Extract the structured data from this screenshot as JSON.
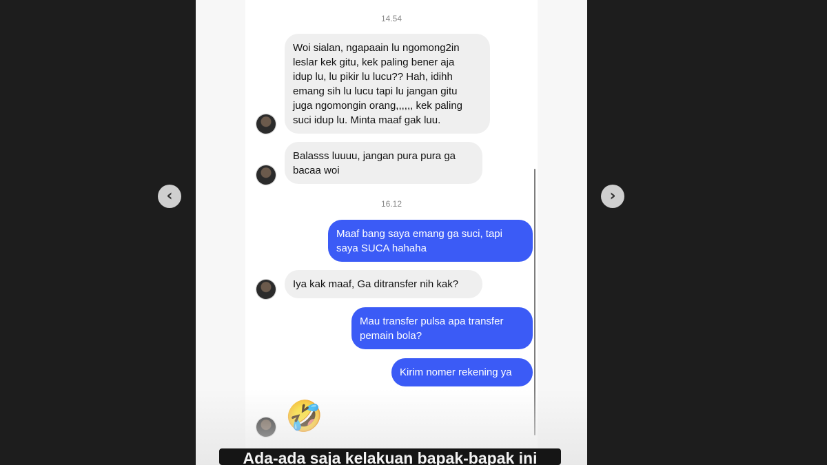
{
  "timestamps": [
    "14.54",
    "16.12"
  ],
  "messages": [
    {
      "direction": "incoming",
      "text": "Woi sialan, ngapaain lu ngomong2in\nleslar kek gitu, kek paling bener aja\nidup lu, lu pikir lu lucu?? Hah, idihh\nemang sih lu lucu tapi lu jangan gitu\njuga ngomongin orang,,,,,, kek paling\nsuci idup lu. Minta maaf gak luu."
    },
    {
      "direction": "incoming",
      "text": "Balasss luuuu, jangan pura pura ga\nbacaa woi"
    },
    {
      "direction": "outgoing",
      "text": "Maaf bang saya emang ga suci, tapi\nsaya SUCA hahaha"
    },
    {
      "direction": "incoming",
      "text": "Iya kak maaf, Ga ditransfer nih kak?"
    },
    {
      "direction": "outgoing",
      "text": "Mau transfer pulsa apa transfer\npemain bola?"
    },
    {
      "direction": "outgoing",
      "text": "Kirim nomer rekening ya"
    },
    {
      "direction": "incoming",
      "text": "🤣"
    }
  ],
  "caption": "Ada-ada saja kelakuan bapak-bapak ini",
  "nav": {
    "prev_icon": "chevron-left-icon",
    "next_icon": "chevron-right-icon"
  },
  "colors": {
    "outgoing_bubble": "#3b5bf6",
    "incoming_bubble": "#efefef",
    "background": "#1d1d1d"
  }
}
